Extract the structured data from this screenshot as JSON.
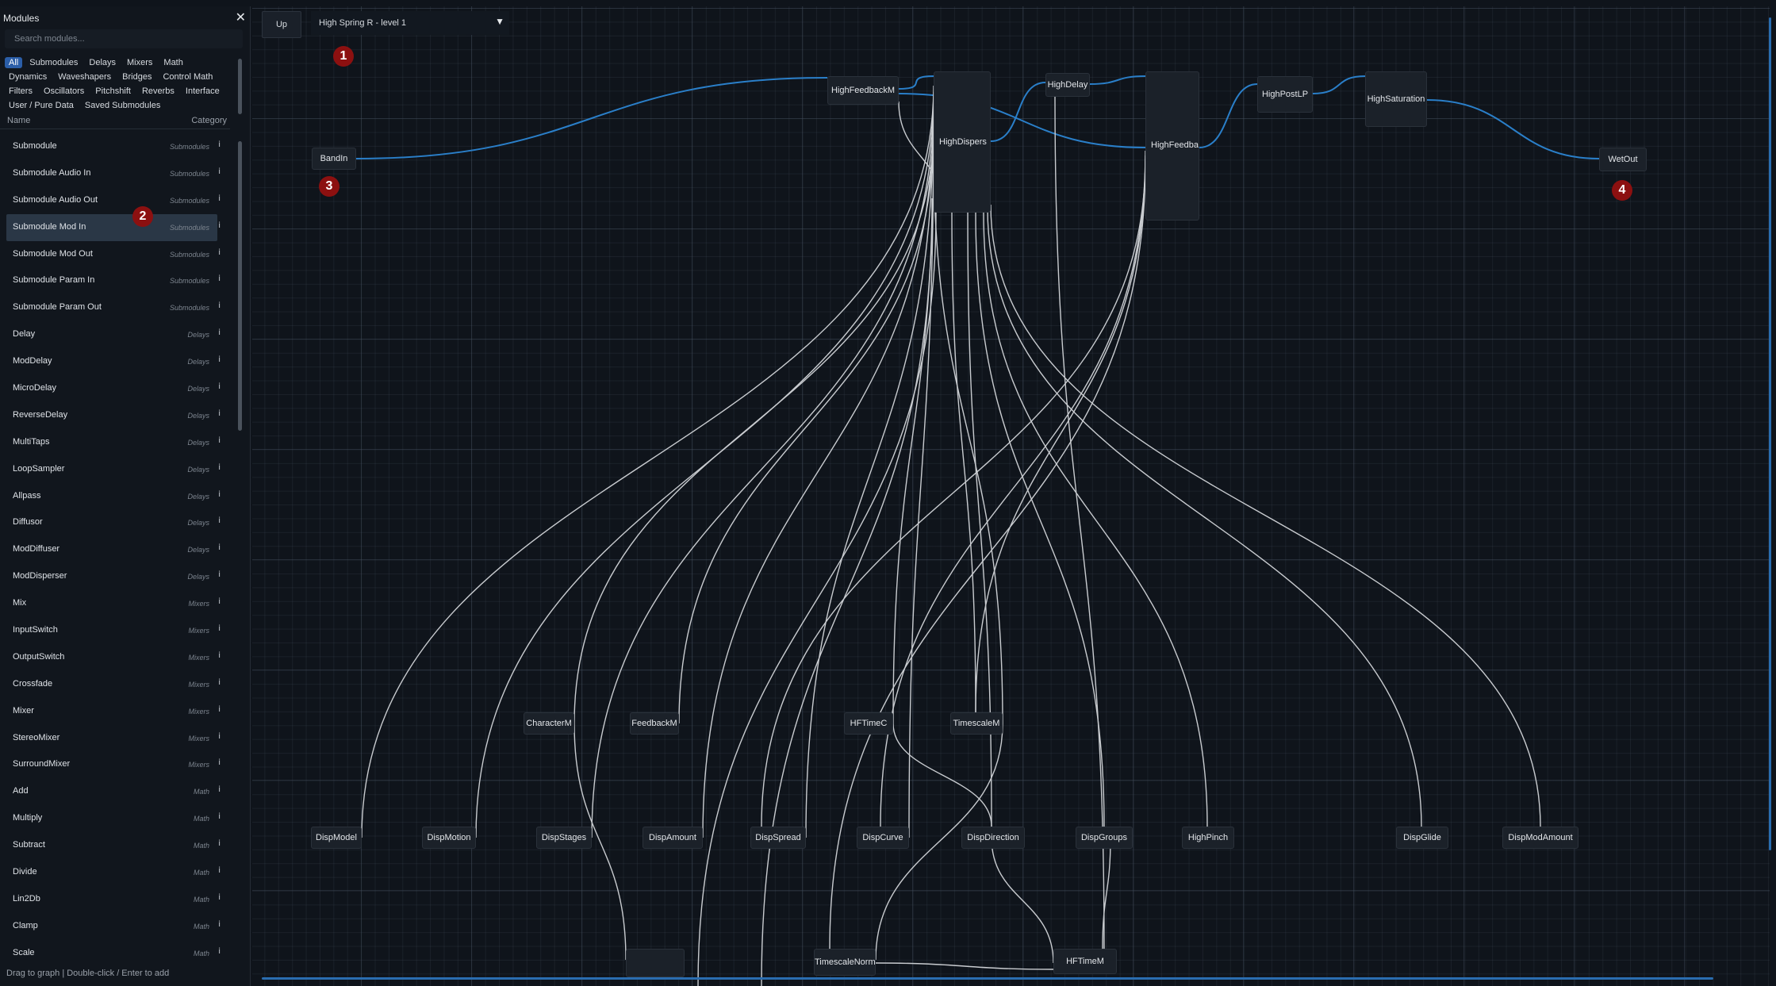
{
  "sidebar": {
    "title": "Modules",
    "close_glyph": "✕",
    "search_placeholder": "Search modules...",
    "filters": [
      [
        {
          "label": "All",
          "active": true
        },
        {
          "label": "Submodules"
        },
        {
          "label": "Delays"
        },
        {
          "label": "Mixers"
        },
        {
          "label": "Math"
        }
      ],
      [
        {
          "label": "Dynamics"
        },
        {
          "label": "Waveshapers"
        },
        {
          "label": "Bridges"
        },
        {
          "label": "Control Math"
        }
      ],
      [
        {
          "label": "Filters"
        },
        {
          "label": "Oscillators"
        },
        {
          "label": "Pitchshift"
        },
        {
          "label": "Reverbs"
        },
        {
          "label": "Interface"
        }
      ],
      [
        {
          "label": "User / Pure Data"
        },
        {
          "label": "Saved Submodules"
        }
      ]
    ],
    "col_name": "Name",
    "col_category": "Category",
    "info_glyph": "i",
    "modules": [
      {
        "name": "Submodule",
        "category": "Submodules"
      },
      {
        "name": "Submodule Audio In",
        "category": "Submodules"
      },
      {
        "name": "Submodule Audio Out",
        "category": "Submodules"
      },
      {
        "name": "Submodule Mod In",
        "category": "Submodules",
        "selected": true
      },
      {
        "name": "Submodule Mod Out",
        "category": "Submodules"
      },
      {
        "name": "Submodule Param In",
        "category": "Submodules"
      },
      {
        "name": "Submodule Param Out",
        "category": "Submodules"
      },
      {
        "name": "Delay",
        "category": "Delays"
      },
      {
        "name": "ModDelay",
        "category": "Delays"
      },
      {
        "name": "MicroDelay",
        "category": "Delays"
      },
      {
        "name": "ReverseDelay",
        "category": "Delays"
      },
      {
        "name": "MultiTaps",
        "category": "Delays"
      },
      {
        "name": "LoopSampler",
        "category": "Delays"
      },
      {
        "name": "Allpass",
        "category": "Delays"
      },
      {
        "name": "Diffusor",
        "category": "Delays"
      },
      {
        "name": "ModDiffuser",
        "category": "Delays"
      },
      {
        "name": "ModDisperser",
        "category": "Delays"
      },
      {
        "name": "Mix",
        "category": "Mixers"
      },
      {
        "name": "InputSwitch",
        "category": "Mixers"
      },
      {
        "name": "OutputSwitch",
        "category": "Mixers"
      },
      {
        "name": "Crossfade",
        "category": "Mixers"
      },
      {
        "name": "Mixer",
        "category": "Mixers"
      },
      {
        "name": "StereoMixer",
        "category": "Mixers"
      },
      {
        "name": "SurroundMixer",
        "category": "Mixers"
      },
      {
        "name": "Add",
        "category": "Math"
      },
      {
        "name": "Multiply",
        "category": "Math"
      },
      {
        "name": "Subtract",
        "category": "Math"
      },
      {
        "name": "Divide",
        "category": "Math"
      },
      {
        "name": "Lin2Db",
        "category": "Math"
      },
      {
        "name": "Clamp",
        "category": "Math"
      },
      {
        "name": "Scale",
        "category": "Math"
      }
    ],
    "footer": "Drag to graph  |  Double-click / Enter to add"
  },
  "toolbar": {
    "up_label": "Up",
    "level": "High Spring R - level 1",
    "chevron_glyph": "▼"
  },
  "markers": [
    "1",
    "2",
    "3",
    "4"
  ],
  "nodes": [
    {
      "id": "bandin",
      "label": "BandIn"
    },
    {
      "id": "highfeedbackm",
      "label": "HighFeedbackM"
    },
    {
      "id": "highdispers",
      "label": "HighDispers"
    },
    {
      "id": "highdelay",
      "label": "HighDelay"
    },
    {
      "id": "highfeedbacksc",
      "label": "HighFeedbackSc"
    },
    {
      "id": "highpostlp",
      "label": "HighPostLP"
    },
    {
      "id": "highsaturation",
      "label": "HighSaturation"
    },
    {
      "id": "wetout",
      "label": "WetOut"
    },
    {
      "id": "characterm",
      "label": "CharacterM"
    },
    {
      "id": "feedbackm",
      "label": "FeedbackM"
    },
    {
      "id": "hftimec",
      "label": "HFTimeC"
    },
    {
      "id": "timescalem",
      "label": "TimescaleM"
    },
    {
      "id": "dispmodel",
      "label": "DispModel"
    },
    {
      "id": "dispmotion",
      "label": "DispMotion"
    },
    {
      "id": "dispstages",
      "label": "DispStages"
    },
    {
      "id": "dispamount",
      "label": "DispAmount"
    },
    {
      "id": "dispspread",
      "label": "DispSpread"
    },
    {
      "id": "dispcurve",
      "label": "DispCurve"
    },
    {
      "id": "dispdirection",
      "label": "DispDirection"
    },
    {
      "id": "dispgroups",
      "label": "DispGroups"
    },
    {
      "id": "highpinch",
      "label": "HighPinch"
    },
    {
      "id": "dispglide",
      "label": "DispGlide"
    },
    {
      "id": "dispmodamount",
      "label": "DispModAmount"
    },
    {
      "id": "blank",
      "label": ""
    },
    {
      "id": "timescalenorm",
      "label": "TimescaleNorm"
    },
    {
      "id": "hftimem",
      "label": "HFTimeM"
    }
  ],
  "colors": {
    "wire_audio": "#2a7fc9",
    "wire_mod": "#c9ccd0",
    "accent": "#2b5ea8",
    "marker": "#8c1010"
  }
}
